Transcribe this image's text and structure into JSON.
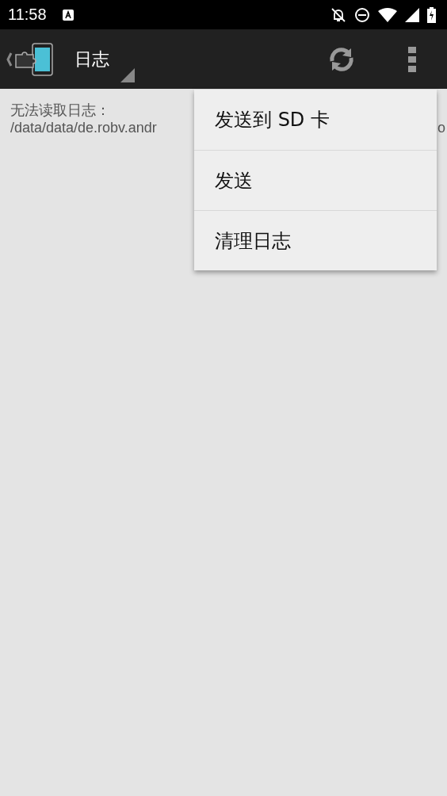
{
  "status_bar": {
    "time": "11:58"
  },
  "toolbar": {
    "title": "日志"
  },
  "content": {
    "message": "无法读取日志：",
    "path_visible": "/data/data/de.robv.andr",
    "path_tail": "o"
  },
  "menu": {
    "items": [
      {
        "label": "发送到 SD 卡"
      },
      {
        "label": "发送"
      },
      {
        "label": "清理日志"
      }
    ]
  }
}
